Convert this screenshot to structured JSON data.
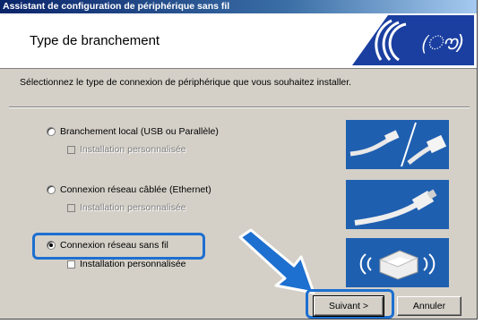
{
  "window": {
    "title": "Assistant de configuration de périphérique sans fil"
  },
  "header": {
    "title": "Type de branchement"
  },
  "instruction": "Sélectionnez le type de connexion de périphérique que vous souhaitez installer.",
  "options": [
    {
      "label": "Branchement local (USB ou Parallèle)",
      "sub_label": "Installation personnalisée",
      "selected": false,
      "icon": "usb-parallel-cable-icon"
    },
    {
      "label": "Connexion réseau câblée (Ethernet)",
      "sub_label": "Installation personnalisée",
      "selected": false,
      "icon": "ethernet-cable-icon"
    },
    {
      "label": "Connexion réseau sans fil",
      "sub_label": "Installation personnalisée",
      "selected": true,
      "icon": "wireless-printer-icon"
    }
  ],
  "buttons": {
    "next": "Suivant >",
    "cancel": "Annuler"
  },
  "colors": {
    "titlebar": "#0a246a",
    "highlight": "#1d6fd0",
    "thumbnail_bg": "#1f5fb0",
    "logo_blue": "#1a3fa0"
  }
}
